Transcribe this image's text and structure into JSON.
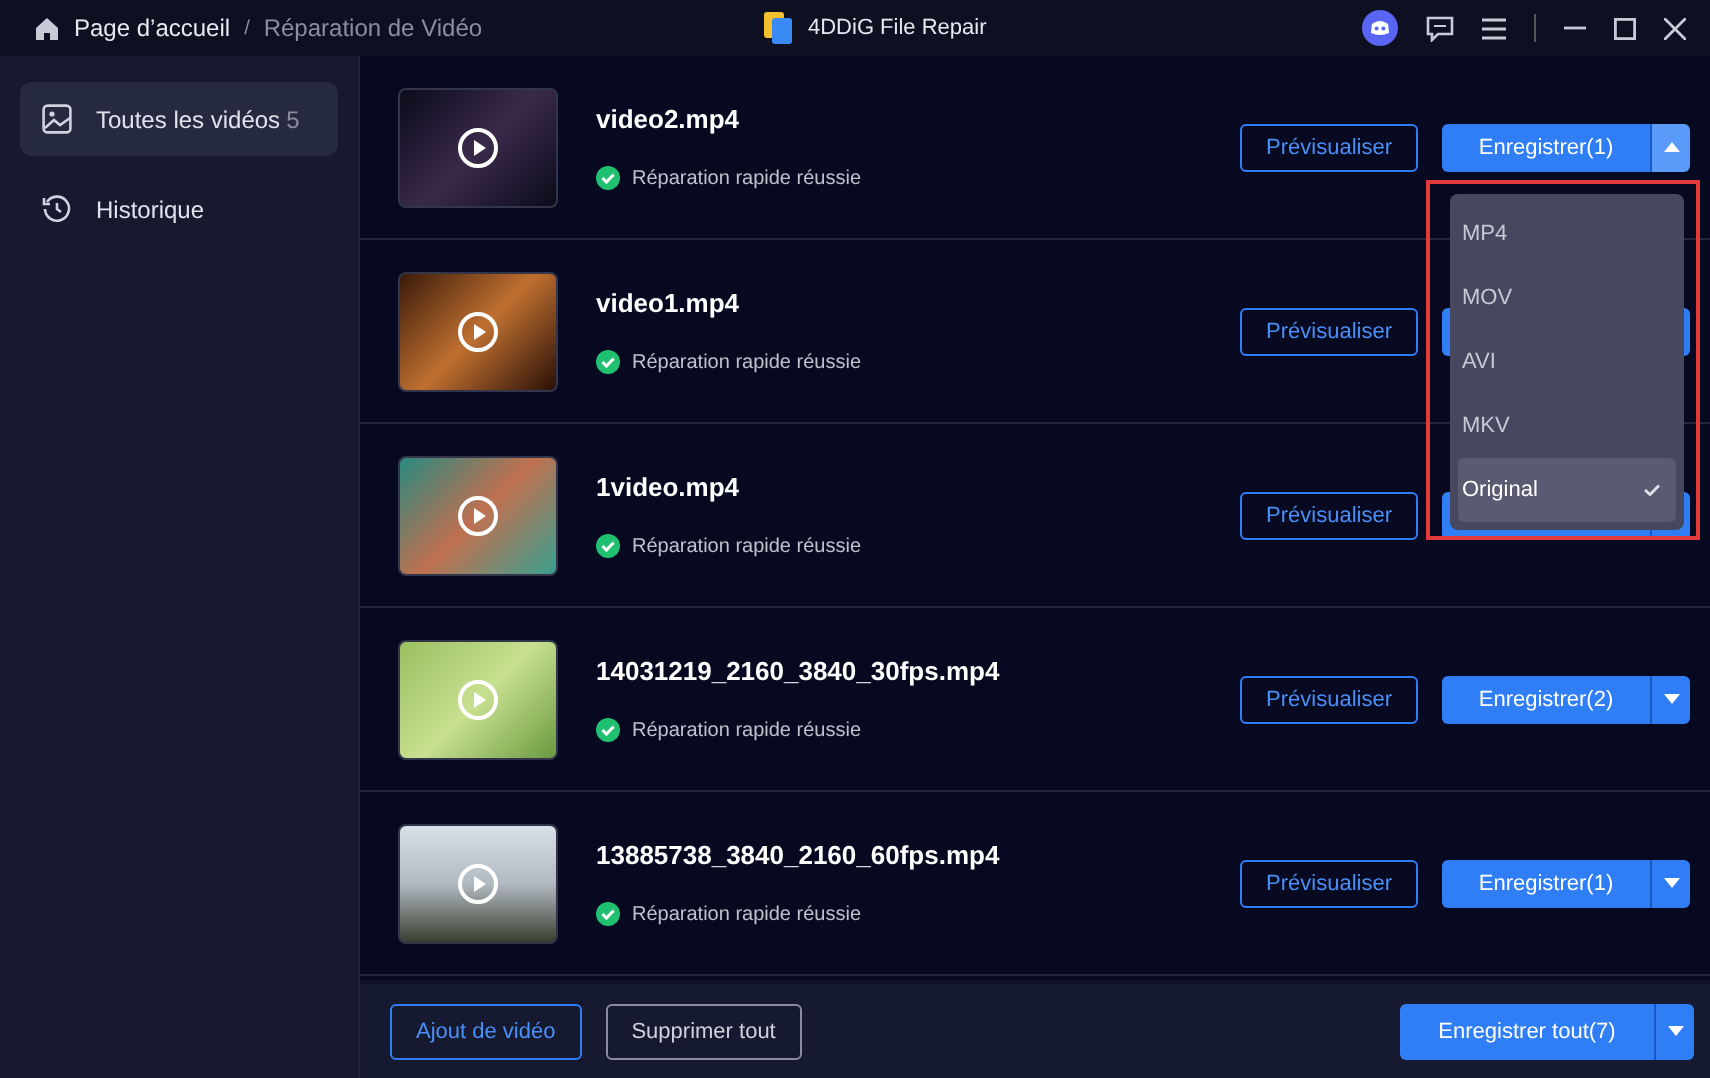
{
  "title_bar": {
    "breadcrumb": [
      "Page d’accueil",
      "Réparation de Vidéo"
    ],
    "breadcrumb_separator": "/",
    "app_name": "4DDiG File Repair"
  },
  "sidebar": {
    "items": [
      {
        "kind": "gallery",
        "label": "Toutes les vidéos",
        "count": "5",
        "selected": true
      },
      {
        "kind": "history",
        "label": "Historique",
        "selected": false
      }
    ]
  },
  "videos": [
    {
      "name": "video2.mp4",
      "status": "Réparation rapide réussie",
      "preview": "Prévisualiser",
      "save": "Enregistrer(1)",
      "menu_open": true
    },
    {
      "name": "video1.mp4",
      "status": "Réparation rapide réussie",
      "preview": "Prévisualiser",
      "menu_open": false
    },
    {
      "name": "1video.mp4",
      "status": "Réparation rapide réussie",
      "preview": "Prévisualiser",
      "menu_open": false
    },
    {
      "name": "14031219_2160_3840_30fps.mp4",
      "status": "Réparation rapide réussie",
      "preview": "Prévisualiser",
      "save": "Enregistrer(2)",
      "menu_open": false
    },
    {
      "name": "13885738_3840_2160_60fps.mp4",
      "status": "Réparation rapide réussie",
      "preview": "Prévisualiser",
      "save": "Enregistrer(1)",
      "menu_open": false
    }
  ],
  "format_menu": {
    "options": [
      {
        "label": "MP4",
        "selected": false
      },
      {
        "label": "MOV",
        "selected": false
      },
      {
        "label": "AVI",
        "selected": false
      },
      {
        "label": "MKV",
        "selected": false
      },
      {
        "label": "Original",
        "selected": true
      }
    ]
  },
  "footer": {
    "add_button": "Ajout de vidéo",
    "delete_button": "Supprimer tout",
    "save_all_button": "Enregistrer tout(7)"
  }
}
